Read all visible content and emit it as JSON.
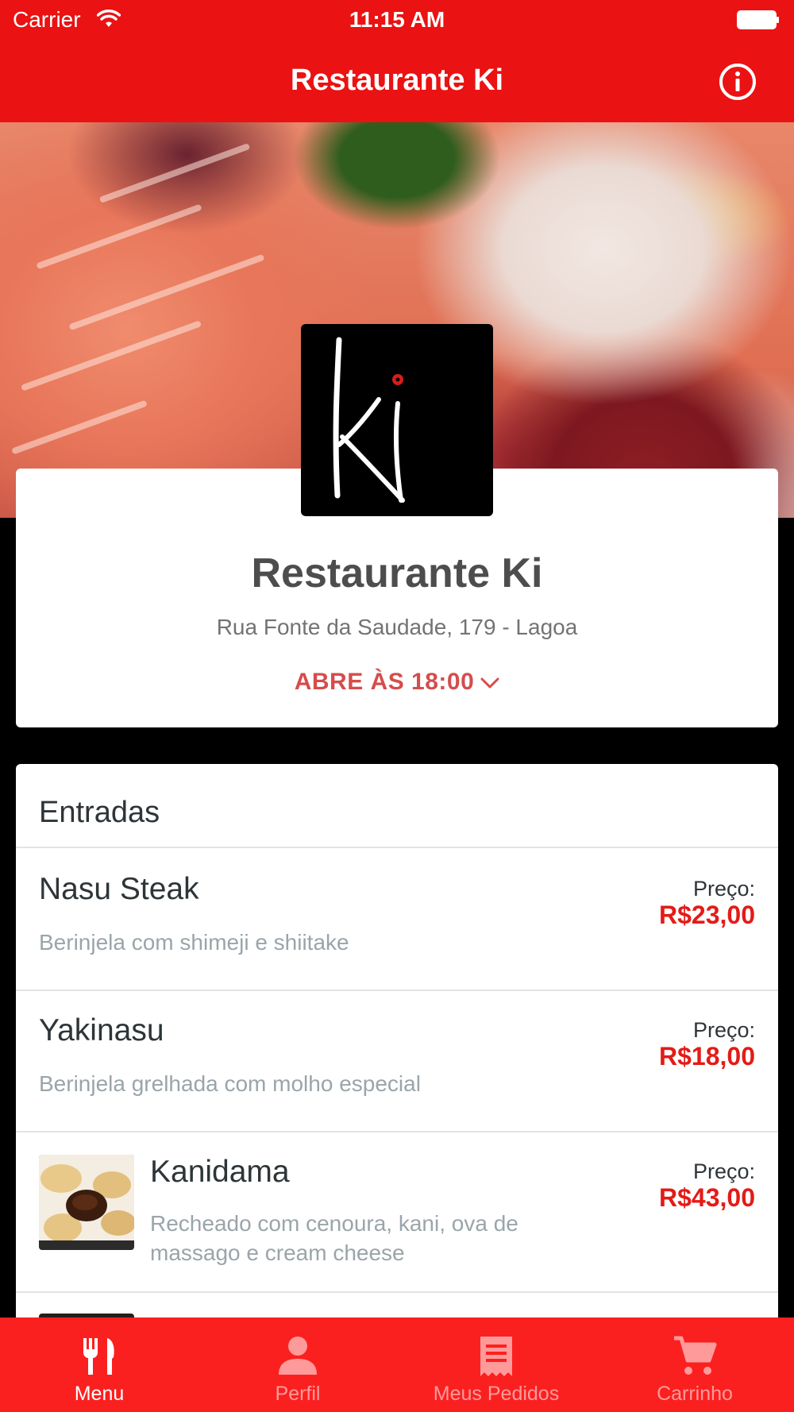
{
  "status_bar": {
    "carrier": "Carrier",
    "time": "11:15 AM"
  },
  "nav": {
    "title": "Restaurante Ki"
  },
  "restaurant": {
    "name": "Restaurante Ki",
    "address": "Rua Fonte da Saudade, 179 - Lagoa",
    "hours": "ABRE ÀS 18:00"
  },
  "menu": {
    "section_title": "Entradas",
    "items": [
      {
        "name": "Nasu Steak",
        "description": "Berinjela com shimeji e shiitake",
        "price_label": "Preço:",
        "price": "R$23,00"
      },
      {
        "name": "Yakinasu",
        "description": "Berinjela grelhada com molho especial",
        "price_label": "Preço:",
        "price": "R$18,00"
      },
      {
        "name": "Kanidama",
        "description_line1": "Recheado com cenoura, kani, ova de",
        "description_line2": "massago e cream cheese",
        "price_label": "Preço:",
        "price": "R$43,00"
      }
    ]
  },
  "tabs": [
    {
      "label": "Menu",
      "icon": "fork-knife-icon",
      "active": true
    },
    {
      "label": "Perfil",
      "icon": "person-icon",
      "active": false
    },
    {
      "label": "Meus Pedidos",
      "icon": "receipt-icon",
      "active": false
    },
    {
      "label": "Carrinho",
      "icon": "cart-icon",
      "active": false
    }
  ],
  "colors": {
    "brand_red": "#ea1212",
    "tab_bar_red": "#fb2020",
    "price_red": "#e41b17",
    "hours_red": "#d64c4c",
    "inactive_tab": "#ff9a9a"
  }
}
